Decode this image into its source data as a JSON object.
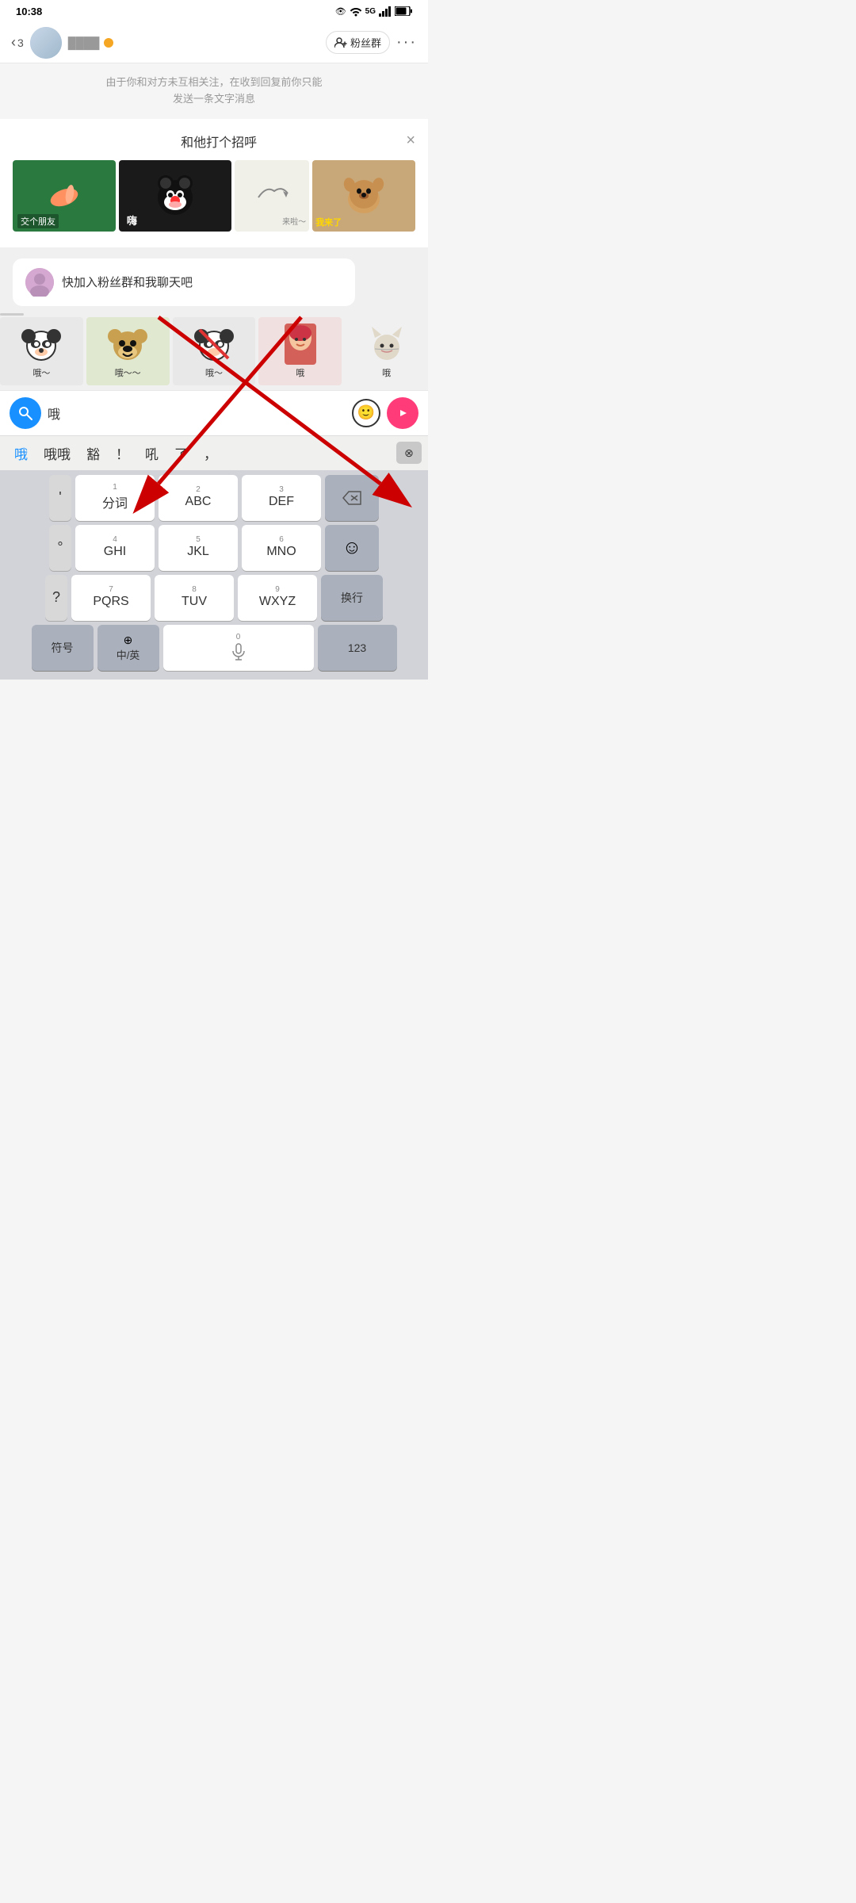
{
  "status": {
    "time": "10:38",
    "icons": "👁 ⦾ 5G▲ 📶 🔋"
  },
  "header": {
    "back_count": "3",
    "name_placeholder": "████",
    "fans_btn": "粉丝群",
    "more_btn": "···"
  },
  "notice": {
    "text": "由于你和对方未互相关注，在收到回复前你只能\n发送一条文字消息"
  },
  "greeting": {
    "title": "和他打个招呼",
    "close": "×",
    "stickers_row1": [
      {
        "label": "交个朋友",
        "bg": "#2a7a40"
      },
      {
        "label": "嗨",
        "bg": "#1a1a1a"
      },
      {
        "label": "来啦～",
        "bg": "#f5f5f0"
      },
      {
        "label": "我来了",
        "bg": "#c8a060"
      }
    ]
  },
  "message": {
    "text": "快加入粉丝群和我聊天吧"
  },
  "stickers_row2": [
    {
      "text": "哦～",
      "bg": "#e8e8e8"
    },
    {
      "text": "哦～～",
      "bg": "#e0e8d0"
    },
    {
      "text": "哦～",
      "bg": "#e8e8e8"
    },
    {
      "text": "哦",
      "bg": "#f0e0e0"
    },
    {
      "text": "哦",
      "bg": "#f0f0f0"
    }
  ],
  "input": {
    "value": "哦",
    "placeholder": ""
  },
  "candidates": {
    "items": [
      "哦",
      "哦哦",
      "豁",
      "！",
      "吼",
      "了",
      "，"
    ],
    "highlight_index": 0,
    "delete_label": "⊗"
  },
  "keyboard": {
    "rows": [
      [
        {
          "side": true,
          "label": "'",
          "bg": "side"
        },
        {
          "num": "1",
          "label": "分词"
        },
        {
          "num": "2",
          "label": "ABC"
        },
        {
          "num": "3",
          "label": "DEF"
        },
        {
          "special": true,
          "label": "⌫"
        }
      ],
      [
        {
          "side": true,
          "label": "°",
          "bg": "side"
        },
        {
          "num": "4",
          "label": "GHI"
        },
        {
          "num": "5",
          "label": "JKL"
        },
        {
          "num": "6",
          "label": "MNO"
        },
        {
          "special": true,
          "label": "☺"
        }
      ],
      [
        {
          "side": true,
          "label": "?",
          "bg": "side"
        },
        {
          "num": "7",
          "label": "PQRS"
        },
        {
          "num": "8",
          "label": "TUV"
        },
        {
          "num": "9",
          "label": "WXYZ"
        },
        {
          "special": true,
          "label": "换行"
        }
      ],
      [
        {
          "special": true,
          "label": "符号"
        },
        {
          "special": true,
          "label": "中/英",
          "sub": "⊕"
        },
        {
          "num": "0",
          "label": "🎤",
          "space": true
        },
        {
          "special": true,
          "label": "123"
        }
      ]
    ],
    "backspace_label": "⌫",
    "enter_label": "换行",
    "symbol_label": "符号",
    "lang_label": "中/英",
    "num_label": "123"
  },
  "arrows": {
    "description": "Two red diagonal arrows pointing to input field and send button"
  }
}
